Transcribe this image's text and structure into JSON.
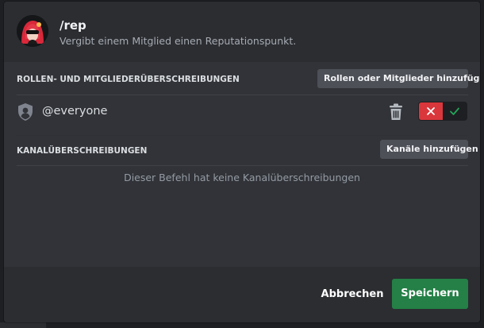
{
  "command": {
    "name": "/rep",
    "description": "Vergibt einem Mitglied einen Reputationspunkt."
  },
  "roles_section": {
    "label": "ROLLEN- UND MITGLIEDERÜBERSCHREIBUNGEN",
    "add_button": "Rollen oder Mitglieder hinzufügen",
    "entries": [
      {
        "name": "@everyone",
        "state": "denied"
      }
    ]
  },
  "channels_section": {
    "label": "KANALÜBERSCHREIBUNGEN",
    "add_button": "Kanäle hinzufügen",
    "empty_text": "Dieser Befehl hat keine Kanalüberschreibungen"
  },
  "footer": {
    "cancel_label": "Abbrechen",
    "save_label": "Speichern"
  },
  "colors": {
    "deny": "#da373c",
    "save": "#248046"
  },
  "icons": {
    "role": "shield-user-icon",
    "delete": "trash-icon",
    "deny": "x-icon",
    "allow": "check-icon"
  }
}
